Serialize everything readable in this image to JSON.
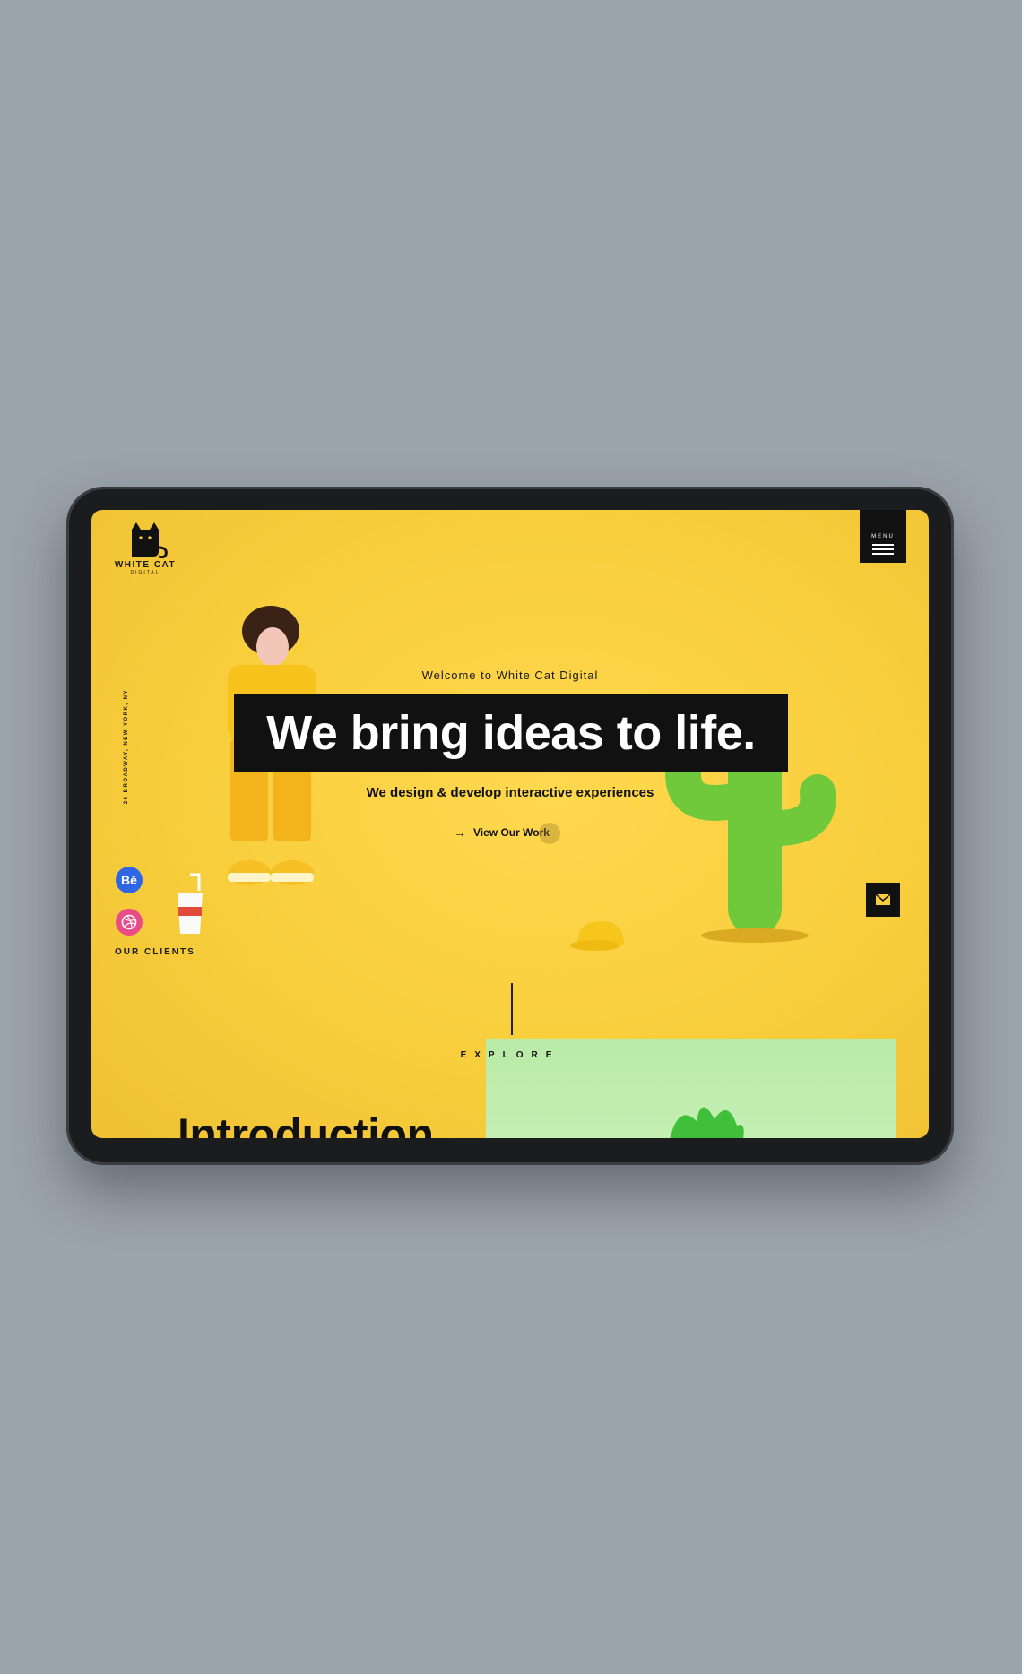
{
  "brand": {
    "name": "WHITE CAT",
    "sub": "DIGITAL"
  },
  "menu": {
    "label": "MENU"
  },
  "address": "26 BROADWAY, NEW YORK, NY",
  "hero": {
    "welcome": "Welcome to White Cat Digital",
    "headline": "We bring ideas to life.",
    "subhead": "We design & develop interactive experiences",
    "cta_label": "View Our Work"
  },
  "social": {
    "behance": "Bē",
    "dribbble": "dribbble-icon"
  },
  "clients_label": "OUR CLIENTS",
  "explore_label": "EXPLORE",
  "intro_heading": "Introduction",
  "colors": {
    "background": "#9ba3ab",
    "screen": "#f8ce3c",
    "ink": "#111111",
    "accent_green": "#7ad33d"
  }
}
